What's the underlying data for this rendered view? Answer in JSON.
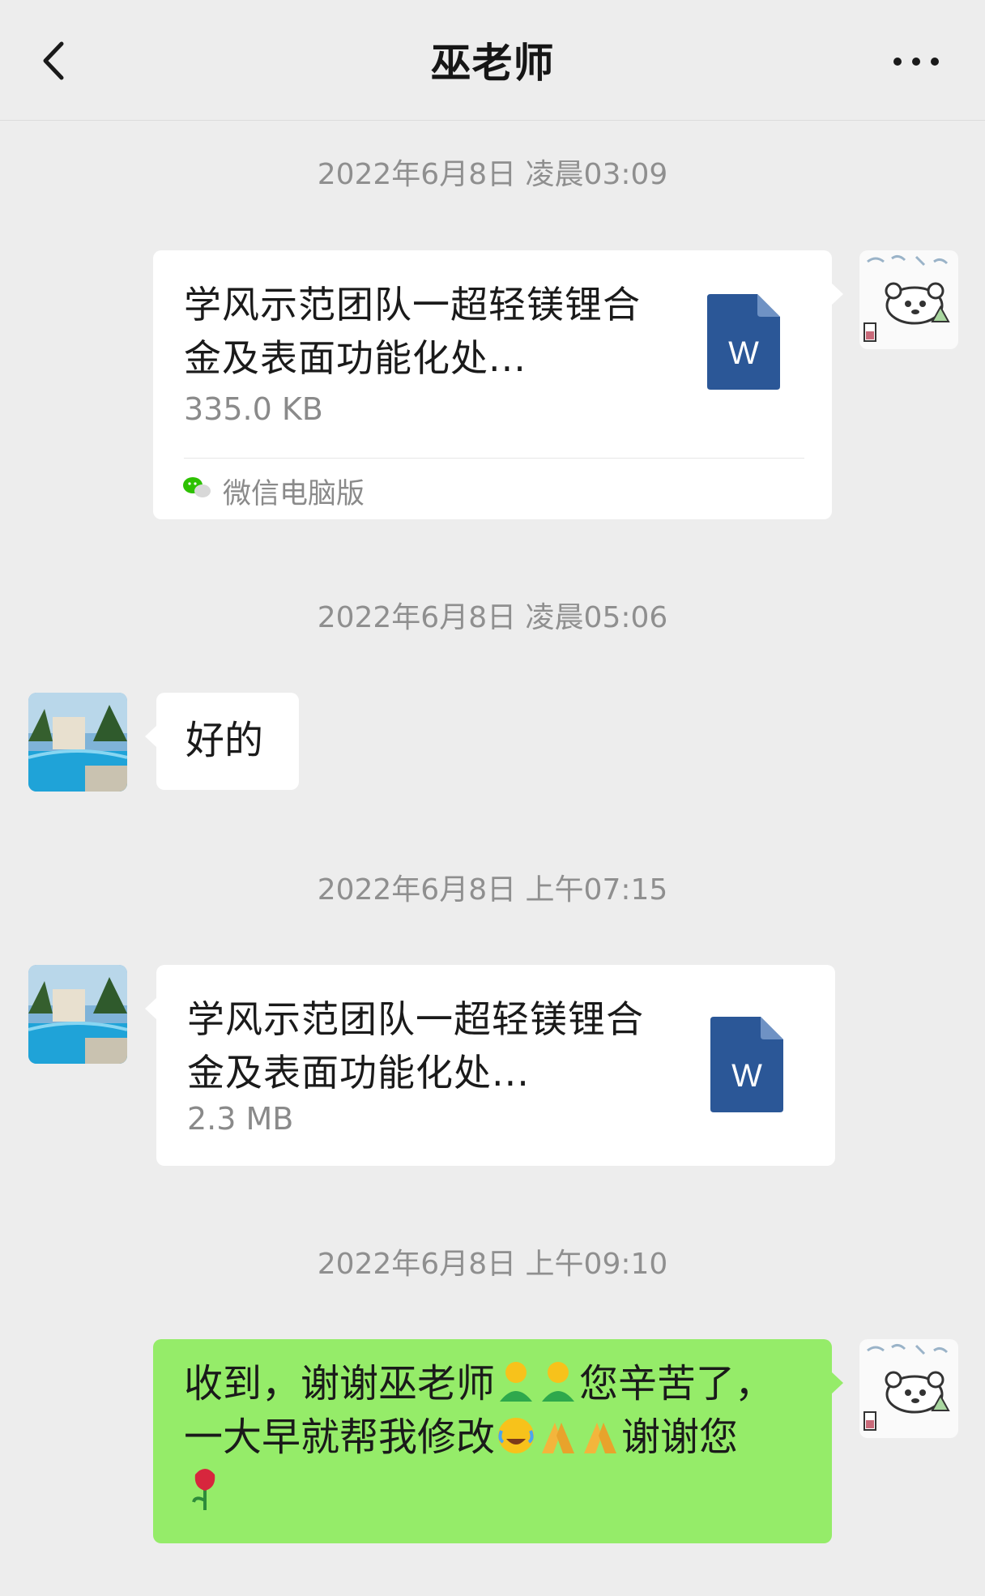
{
  "header": {
    "title": "巫老师"
  },
  "messages": [
    {
      "time": "2022年6月8日 凌晨03:09",
      "file_name": "学风示范团队一超轻镁锂合金及表面功能化处...",
      "file_size": "335.0 KB",
      "file_icon_letter": "W",
      "source": "微信电脑版"
    },
    {
      "time": "2022年6月8日 凌晨05:06",
      "text": "好的"
    },
    {
      "time": "2022年6月8日 上午07:15",
      "file_name": "学风示范团队一超轻镁锂合金及表面功能化处...",
      "file_size": "2.3 MB",
      "file_icon_letter": "W"
    },
    {
      "time": "2022年6月8日 上午09:10",
      "text_line1_a": "收到，谢谢巫老师",
      "text_line1_b": "您辛苦了，",
      "text_line2_a": "一大早就帮我修改",
      "text_line2_b": "谢谢您"
    }
  ],
  "icons": {
    "back": "chevron-left-icon",
    "more": "more-dots-icon",
    "file": "word-doc-icon",
    "emoji_person": "person-emoji-icon",
    "emoji_laugh": "laugh-crying-emoji-icon",
    "emoji_pray": "pray-hands-emoji-icon",
    "emoji_rose": "rose-emoji-icon"
  },
  "colors": {
    "background": "#ededed",
    "bubble_white": "#ffffff",
    "bubble_green": "#95ec69",
    "word_blue": "#2b5797",
    "timestamp": "#8f8f8f"
  }
}
